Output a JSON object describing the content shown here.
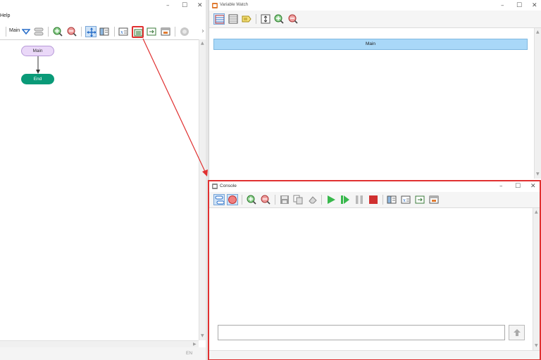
{
  "left": {
    "menu": {
      "help": "Help"
    },
    "toolbar": {
      "function_select": "Main"
    },
    "flow": {
      "start_node": "Main",
      "end_node": "End"
    },
    "status": {
      "lang": "EN"
    }
  },
  "variable_watch": {
    "title": "Variable Watch",
    "tab": "Main"
  },
  "console": {
    "title": "Console",
    "input_value": ""
  },
  "colors": {
    "highlight": "#e03030",
    "start_node": "#ead8f8",
    "end_node": "#0a9a78",
    "watch_tab": "#a9d8f8"
  }
}
